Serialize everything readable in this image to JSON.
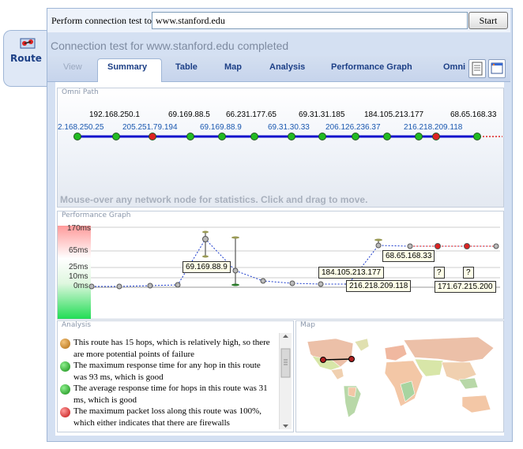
{
  "side_tab": {
    "label": "Route"
  },
  "connection": {
    "label": "Perform connection test to",
    "host": "www.stanford.edu",
    "start_label": "Start"
  },
  "status": "Connection test for www.stanford.edu completed",
  "tabs": [
    {
      "label": "View",
      "state": "disabled"
    },
    {
      "label": "Summary",
      "state": "selected"
    },
    {
      "label": "Table",
      "state": "normal"
    },
    {
      "label": "Map",
      "state": "normal"
    },
    {
      "label": "Analysis",
      "state": "normal"
    },
    {
      "label": "Performance Graph",
      "state": "normal"
    },
    {
      "label": "Omni",
      "state": "normal"
    }
  ],
  "toolbar_icons": [
    "document-icon",
    "window-icon"
  ],
  "omni_path": {
    "title": "Omni Path",
    "message": "Mouse-over any network node for statistics. Click and drag to move.",
    "top_labels": [
      "192.168.250.1",
      "69.169.88.5",
      "66.231.177.65",
      "69.31.31.185",
      "184.105.213.177",
      "68.65.168.33"
    ],
    "bottom_labels": [
      "2.168.250.25",
      "205.251.79.194",
      "69.169.88.9",
      "69.31.30.33",
      "206.126.236.37",
      "216.218.209.118"
    ],
    "node_colors": [
      "green",
      "green",
      "red",
      "green",
      "green",
      "green",
      "green",
      "green",
      "green",
      "green",
      "green",
      "red",
      "green"
    ]
  },
  "performance_graph": {
    "title": "Performance Graph",
    "y_labels": [
      "170ms",
      "65ms",
      "25ms",
      "10ms",
      "0ms"
    ],
    "callouts": [
      "69.169.88.9",
      "184.105.213.177",
      "68.65.168.33",
      "216.218.209.118",
      "171.67.215.200"
    ],
    "unknown_marks": [
      "?",
      "?"
    ]
  },
  "analysis": {
    "title": "Analysis",
    "items": [
      {
        "status": "orange",
        "text": "This route has 15 hops, which is relatively high, so there are more potential points of failure"
      },
      {
        "status": "green",
        "text": "The maximum response time for any hop in this route was 93 ms, which is good"
      },
      {
        "status": "green",
        "text": "The average response time for hops in this route was 31 ms, which is good"
      },
      {
        "status": "red",
        "text": "The maximum packet loss along this route was 100%, which either indicates that there are firewalls"
      }
    ]
  },
  "map": {
    "title": "Map"
  },
  "colors": {
    "accent": "#1c3f86",
    "node_green": "#22bb22",
    "node_red": "#dd2222",
    "node_orange": "#c8882a",
    "route_line": "#1010cc"
  }
}
